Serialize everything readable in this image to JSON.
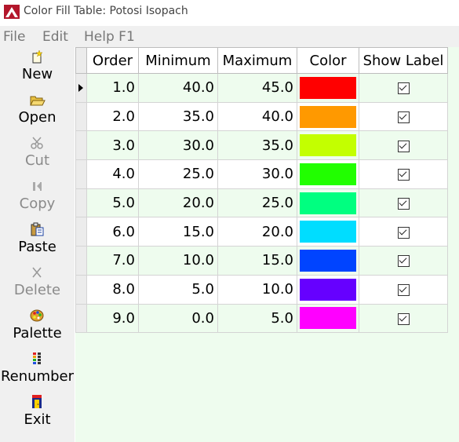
{
  "window": {
    "title": "Color Fill Table: Potosi Isopach"
  },
  "menu": [
    "File",
    "Edit",
    "Help F1"
  ],
  "toolbar": [
    {
      "label": "New",
      "icon": "new-icon",
      "enabled": true
    },
    {
      "label": "Open",
      "icon": "open-folder-icon",
      "enabled": true
    },
    {
      "label": "Cut",
      "icon": "scissors-icon",
      "enabled": false
    },
    {
      "label": "Copy",
      "icon": "copy-icon",
      "enabled": false
    },
    {
      "label": "Paste",
      "icon": "paste-icon",
      "enabled": true
    },
    {
      "label": "Delete",
      "icon": "delete-x-icon",
      "enabled": false
    },
    {
      "label": "Palette",
      "icon": "palette-icon",
      "enabled": true
    },
    {
      "label": "Renumber",
      "icon": "renumber-icon",
      "enabled": true
    },
    {
      "label": "Exit",
      "icon": "exit-door-icon",
      "enabled": true
    }
  ],
  "table": {
    "columns": [
      "Order",
      "Minimum",
      "Maximum",
      "Color",
      "Show Label"
    ],
    "current_row": 0,
    "rows": [
      {
        "order": "1.0",
        "minimum": "40.0",
        "maximum": "45.0",
        "color": "#ff0000",
        "show_label": true
      },
      {
        "order": "2.0",
        "minimum": "35.0",
        "maximum": "40.0",
        "color": "#ff9900",
        "show_label": true
      },
      {
        "order": "3.0",
        "minimum": "30.0",
        "maximum": "35.0",
        "color": "#c3ff00",
        "show_label": true
      },
      {
        "order": "4.0",
        "minimum": "25.0",
        "maximum": "30.0",
        "color": "#21ff00",
        "show_label": true
      },
      {
        "order": "5.0",
        "minimum": "20.0",
        "maximum": "25.0",
        "color": "#00ff80",
        "show_label": true
      },
      {
        "order": "6.0",
        "minimum": "15.0",
        "maximum": "20.0",
        "color": "#00ddff",
        "show_label": true
      },
      {
        "order": "7.0",
        "minimum": "10.0",
        "maximum": "15.0",
        "color": "#0044ff",
        "show_label": true
      },
      {
        "order": "8.0",
        "minimum": "5.0",
        "maximum": "10.0",
        "color": "#6600ff",
        "show_label": true
      },
      {
        "order": "9.0",
        "minimum": "0.0",
        "maximum": "5.0",
        "color": "#ff00ff",
        "show_label": true
      }
    ]
  }
}
